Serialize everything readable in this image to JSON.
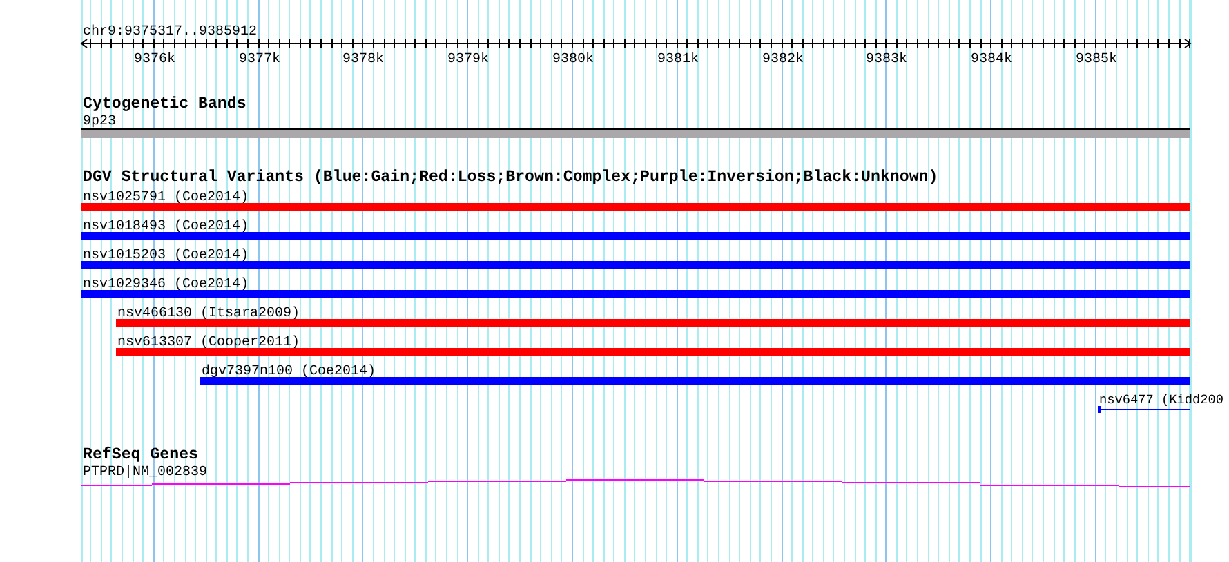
{
  "ruler": {
    "locus": "chr9:9375317..9385912",
    "tick_labels": [
      "9376k",
      "9377k",
      "9378k",
      "9379k",
      "9380k",
      "9381k",
      "9382k",
      "9383k",
      "9384k",
      "9385k"
    ]
  },
  "tracks": [
    {
      "kind": "bands",
      "title": "Cytogenetic Bands",
      "items": [
        {
          "label": "9p23"
        }
      ]
    },
    {
      "kind": "variants",
      "title": "DGV Structural Variants (Blue:Gain;Red:Loss;Brown:Complex;Purple:Inversion;Black:Unknown)",
      "items": [
        {
          "kind": "bar",
          "label": "nsv1025791 (Coe2014)",
          "color": "#ff0000"
        },
        {
          "kind": "bar",
          "label": "nsv1018493 (Coe2014)",
          "color": "#0000ff"
        },
        {
          "kind": "bar",
          "label": "nsv1015203 (Coe2014)",
          "color": "#0000ff"
        },
        {
          "kind": "bar",
          "label": "nsv1029346 (Coe2014)",
          "color": "#0000ff"
        },
        {
          "kind": "bar",
          "label": "nsv466130 (Itsara2009)",
          "color": "#ff0000"
        },
        {
          "kind": "bar",
          "label": "nsv613307 (Cooper2011)",
          "color": "#ff0000"
        },
        {
          "kind": "bar",
          "label": "dgv7397n100 (Coe2014)",
          "color": "#0000ff"
        },
        {
          "kind": "line",
          "label": "nsv6477 (Kidd200",
          "color": "#0000ff"
        }
      ]
    },
    {
      "kind": "genes",
      "title": "RefSeq Genes",
      "items": [
        {
          "label": "PTPRD|NM_002839"
        }
      ]
    }
  ]
}
